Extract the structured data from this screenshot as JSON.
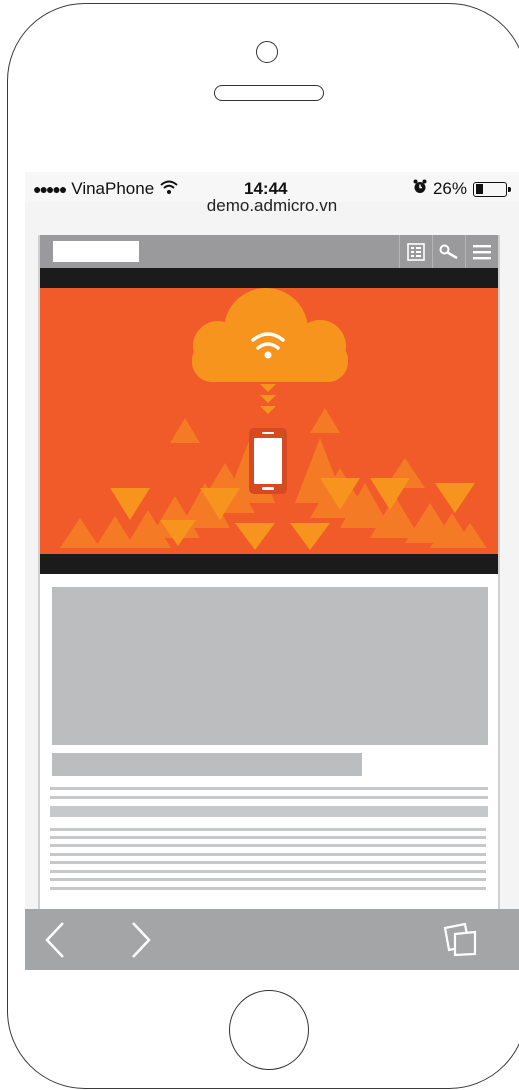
{
  "status_bar": {
    "signal_dots": "●●●●●",
    "carrier": "VinaPhone",
    "time": "14:44",
    "battery_percent": "26%",
    "battery_level": 0.26
  },
  "browser": {
    "url": "demo.admicro.vn"
  },
  "colors": {
    "hero_orange": "#f15a29",
    "cloud_orange": "#f7941d",
    "header_gray": "#9a9a9c",
    "toolbar_gray": "#a4a5a7",
    "placeholder_gray": "#bcbdbf"
  },
  "icons": {
    "header": [
      "list-view-icon",
      "search-icon",
      "hamburger-menu-icon"
    ],
    "toolbar": [
      "back-arrow-icon",
      "forward-arrow-icon",
      "tabs-icon"
    ]
  }
}
